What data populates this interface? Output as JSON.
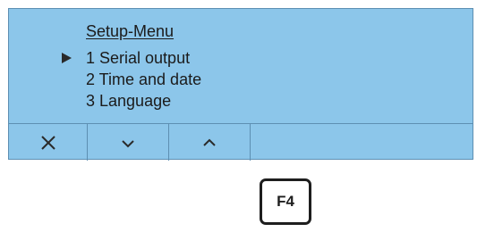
{
  "menu": {
    "title": "Setup-Menu",
    "items": [
      {
        "label": "1 Serial output",
        "selected": true
      },
      {
        "label": "2 Time and date",
        "selected": false
      },
      {
        "label": "3 Language",
        "selected": false
      }
    ],
    "cursor_icon": "triangle-right-icon"
  },
  "softkeys": [
    {
      "icon": "close-icon"
    },
    {
      "icon": "chevron-down-icon"
    },
    {
      "icon": "chevron-up-icon"
    },
    {
      "icon": ""
    }
  ],
  "physical_key": {
    "label": "F4"
  },
  "colors": {
    "lcd_background": "#8cc6ea",
    "lcd_border": "#5d8fb2",
    "text": "#1b1b1b",
    "key_border": "#1e1e1e"
  }
}
